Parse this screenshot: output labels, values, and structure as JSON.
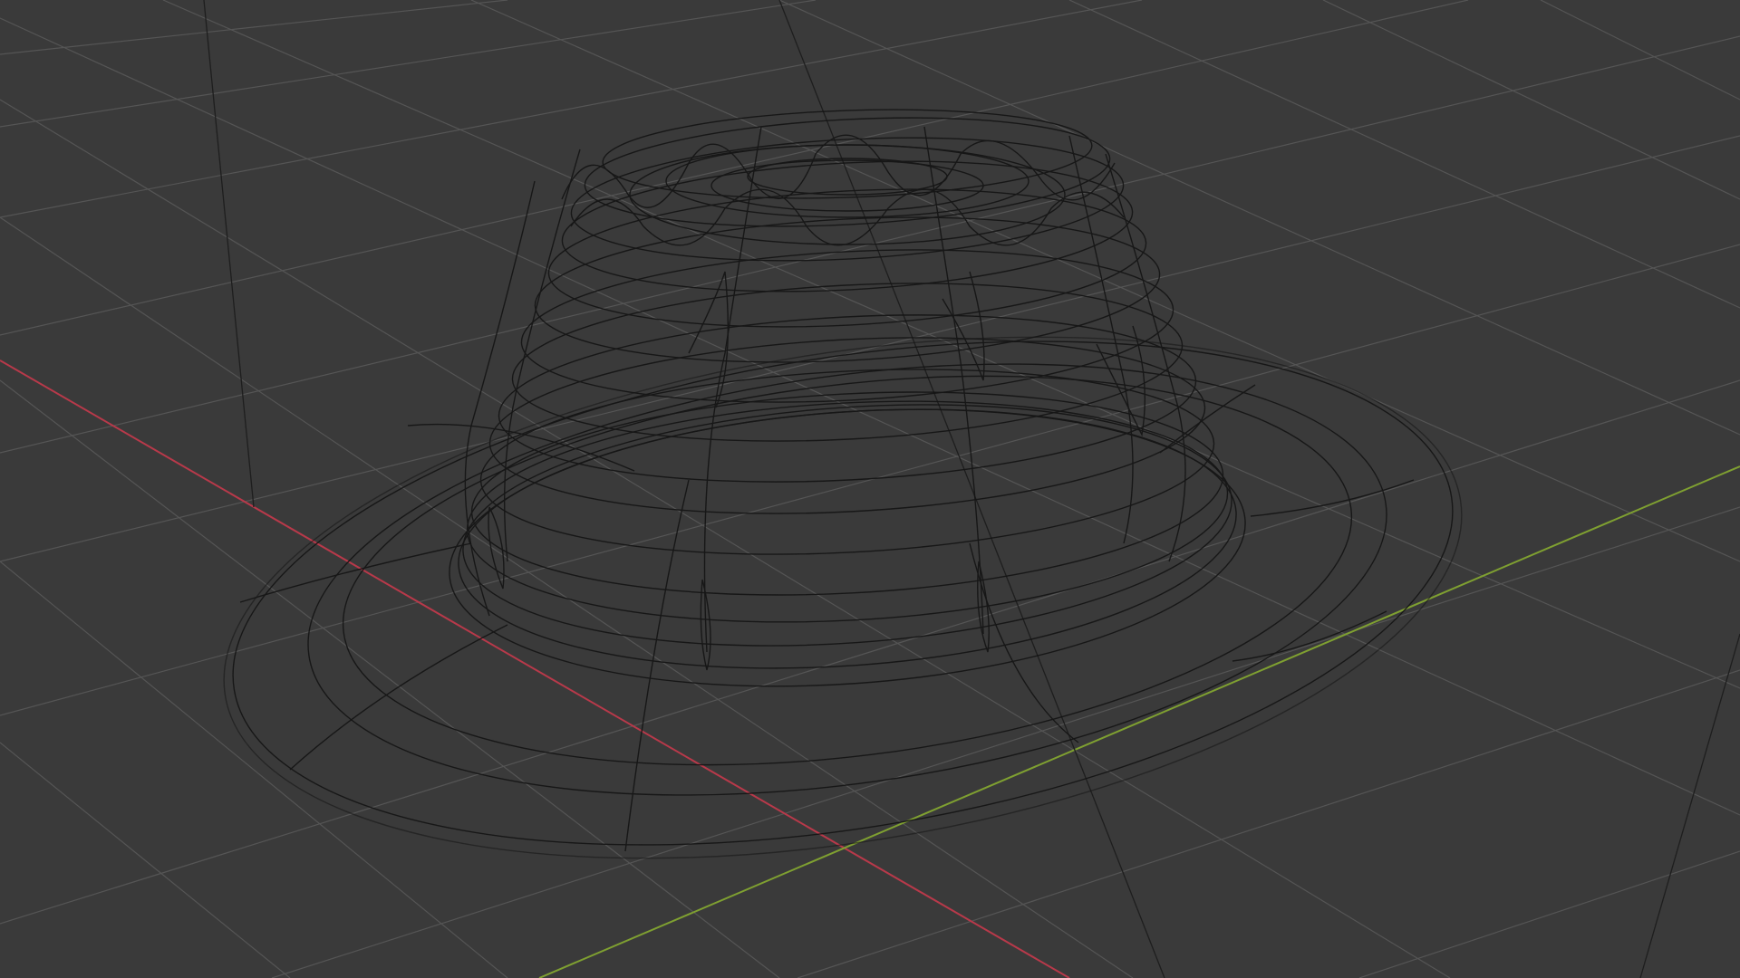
{
  "viewport": {
    "mode": "wireframe",
    "object": "hat-mesh",
    "background_color": "#3a3a3a",
    "grid_color": "#555555",
    "x_axis_color": "#b8394a",
    "y_axis_color": "#7fa031",
    "wire_color": "#141414"
  }
}
